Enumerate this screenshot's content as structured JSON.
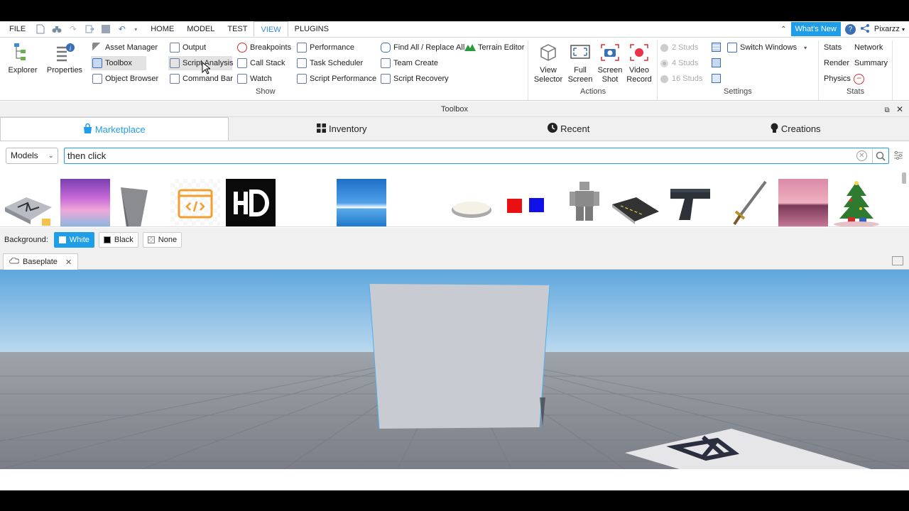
{
  "menubar": {
    "file": "FILE",
    "tabs": [
      "HOME",
      "MODEL",
      "TEST",
      "VIEW",
      "PLUGINS"
    ],
    "whats_new": "What's New",
    "user": "Pixarzz"
  },
  "ribbon": {
    "explorer": "Explorer",
    "properties": "Properties",
    "asset_manager": "Asset Manager",
    "toolbox": "Toolbox",
    "object_browser": "Object Browser",
    "output": "Output",
    "script_analysis": "Script Analysis",
    "command_bar": "Command Bar",
    "breakpoints": "Breakpoints",
    "call_stack": "Call Stack",
    "watch": "Watch",
    "performance": "Performance",
    "task_scheduler": "Task Scheduler",
    "script_performance": "Script Performance",
    "find_replace": "Find All / Replace All",
    "team_create": "Team Create",
    "script_recovery": "Script Recovery",
    "terrain_editor": "Terrain Editor",
    "show_group": "Show",
    "view_selector": [
      "View",
      "Selector"
    ],
    "full_screen": [
      "Full",
      "Screen"
    ],
    "screen_shot": [
      "Screen",
      "Shot"
    ],
    "video_record": [
      "Video",
      "Record"
    ],
    "actions_group": "Actions",
    "studs_2": "2 Studs",
    "studs_4": "4 Studs",
    "studs_16": "16 Studs",
    "switch_windows": "Switch Windows",
    "settings_group": "Settings",
    "stats": "Stats",
    "network": "Network",
    "render": "Render",
    "summary": "Summary",
    "physics": "Physics",
    "stats_group": "Stats"
  },
  "toolbox": {
    "title": "Toolbox",
    "tabs": [
      "Marketplace",
      "Inventory",
      "Recent",
      "Creations"
    ],
    "category": "Models",
    "search_value": "then click",
    "bg_label": "Background:",
    "bg_options": [
      "White",
      "Black",
      "None"
    ]
  },
  "document": {
    "tab": "Baseplate"
  },
  "colors": {
    "accent": "#1e9ee8",
    "record": "#e8334a",
    "terrain": "#2a9a3a"
  }
}
